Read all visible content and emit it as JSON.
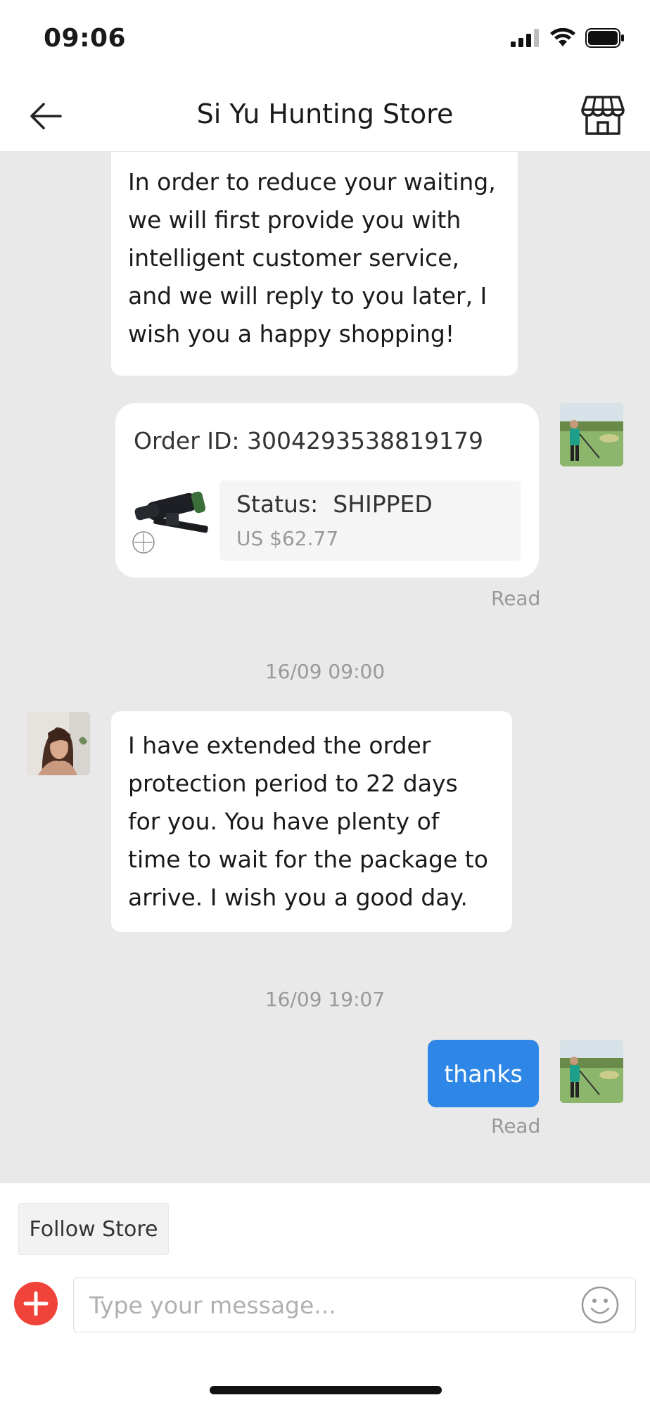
{
  "status_bar": {
    "time": "09:06"
  },
  "header": {
    "title": "Si Yu Hunting Store"
  },
  "messages": {
    "intro": "In order to reduce your waiting, we will first provide you with intelligent customer service, and we will reply to you later, I wish you a happy shopping!",
    "order": {
      "id_label": "Order ID: 3004293538819179",
      "status_label": "Status:  SHIPPED",
      "price": "US $62.77",
      "read": "Read"
    },
    "timestamp_1": "16/09 09:00",
    "protection": "I have extended the order protection period to 22 days for you. You have plenty of time to wait for the package to arrive. I wish you a good day.",
    "timestamp_2": "16/09 19:07",
    "thanks": "thanks",
    "thanks_read": "Read"
  },
  "bottom": {
    "follow_label": "Follow Store",
    "input_placeholder": "Type your message..."
  },
  "colors": {
    "accent_blue": "#2e87e6",
    "plus_red": "#f0443b",
    "chat_bg": "#e9e9e9"
  },
  "icons": [
    "back-arrow-icon",
    "store-icon",
    "plus-icon",
    "emoji-icon",
    "signal-icon",
    "wifi-icon",
    "battery-icon"
  ]
}
